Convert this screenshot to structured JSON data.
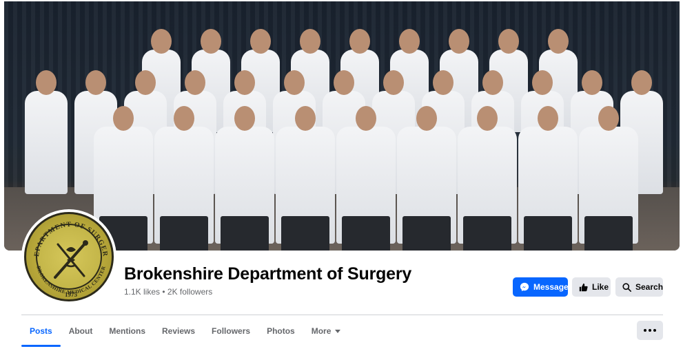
{
  "page": {
    "title": "Brokenshire Department of Surgery",
    "stats": "1.1K likes • 2K followers"
  },
  "logo": {
    "top_text": "DEPARTMENT OF SURGERY",
    "bottom_text": "BROKENSHIRE MEDICAL CENTER",
    "year": "1975"
  },
  "actions": {
    "message_label": "Message",
    "like_label": "Like",
    "search_label": "Search"
  },
  "tabs": [
    {
      "label": "Posts",
      "active": true
    },
    {
      "label": "About"
    },
    {
      "label": "Mentions"
    },
    {
      "label": "Reviews"
    },
    {
      "label": "Followers"
    },
    {
      "label": "Photos"
    },
    {
      "label": "More",
      "has_dropdown": true
    }
  ],
  "icons": {
    "message": "messenger-icon",
    "like": "thumbs-up-icon",
    "search": "search-icon",
    "more_dropdown": "caret-down-icon",
    "overflow": "more-horizontal-icon"
  },
  "colors": {
    "accent": "#0866ff",
    "secondary_button": "#e4e6eb",
    "muted_text": "#65676b",
    "logo_gold": "#c8b94a"
  }
}
